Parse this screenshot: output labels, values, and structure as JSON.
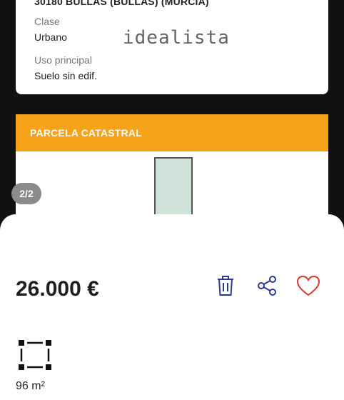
{
  "photo": {
    "address_partial": "30180 BULLAS (BULLAS) (MURCIA)",
    "clase_label": "Clase",
    "clase_value": "Urbano",
    "uso_label": "Uso principal",
    "uso_value": "Suelo sin edif.",
    "watermark": "idealista",
    "section_title": "PARCELA CATASTRAL",
    "counter": "2/2",
    "accent_color": "#f7a21b"
  },
  "listing": {
    "price": "26.000 €",
    "area": "96 m²",
    "icons": [
      "trash-icon",
      "share-icon",
      "heart-icon",
      "area-icon"
    ],
    "icon_color": "#2b3a8f",
    "favorite_color": "#d63a2f"
  }
}
